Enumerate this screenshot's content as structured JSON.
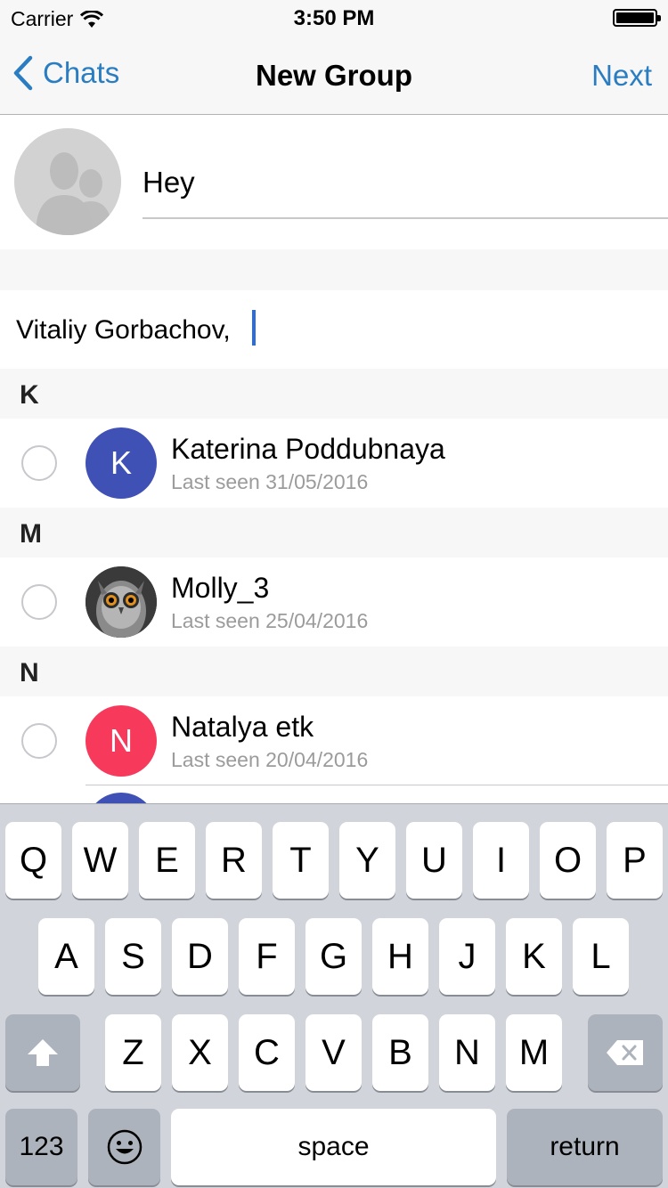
{
  "status_bar": {
    "carrier": "Carrier",
    "time": "3:50 PM"
  },
  "nav": {
    "back_label": "Chats",
    "title": "New Group",
    "next_label": "Next"
  },
  "group": {
    "name": "Hey",
    "avatar_icon": "group-placeholder-icon"
  },
  "selected": {
    "text": "Vitaliy Gorbachov,"
  },
  "sections": [
    {
      "letter": "K"
    },
    {
      "letter": "M"
    },
    {
      "letter": "N"
    }
  ],
  "contacts": [
    {
      "name": "Katerina Poddubnaya",
      "last_seen": "Last seen 31/05/2016",
      "initial": "K",
      "color": "#3f51b5"
    },
    {
      "name": "Molly_3",
      "last_seen": "Last seen 25/04/2016",
      "initial": "",
      "color": "#2b2b2b",
      "photo": "owl-photo"
    },
    {
      "name": "Natalya etk",
      "last_seen": "Last seen 20/04/2016",
      "initial": "N",
      "color": "#f73a5c"
    }
  ],
  "keyboard": {
    "row1": [
      "Q",
      "W",
      "E",
      "R",
      "T",
      "Y",
      "U",
      "I",
      "O",
      "P"
    ],
    "row2": [
      "A",
      "S",
      "D",
      "F",
      "G",
      "H",
      "J",
      "K",
      "L"
    ],
    "row3": [
      "Z",
      "X",
      "C",
      "V",
      "B",
      "N",
      "M"
    ],
    "numbers_label": "123",
    "space_label": "space",
    "return_label": "return",
    "shift_icon": "shift-icon",
    "delete_icon": "delete-icon",
    "emoji_icon": "emoji-icon"
  }
}
